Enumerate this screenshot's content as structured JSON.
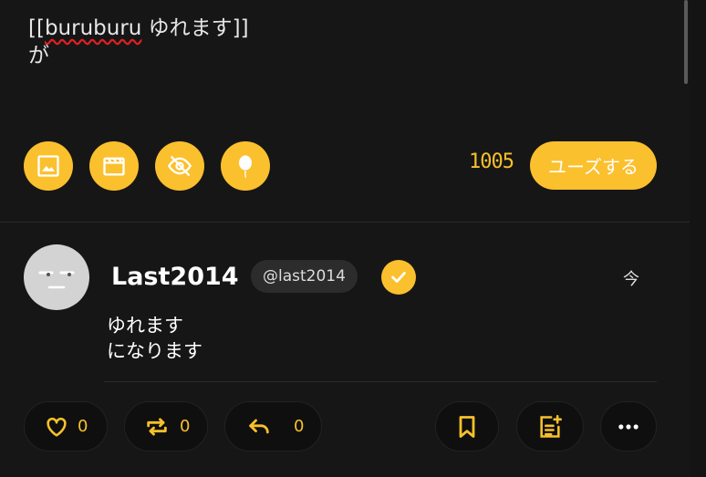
{
  "compose": {
    "line1_prefix": "[[",
    "line1_word": "buruburu",
    "line1_suffix": " ゆれます]]",
    "line2": "が"
  },
  "toolbar": {
    "icons": [
      "image-icon",
      "video-icon",
      "eye-off-icon",
      "balloon-icon"
    ],
    "char_count": "1005",
    "use_label": "ユーズする"
  },
  "post": {
    "display_name": "Last2014",
    "handle": "@last2014",
    "timestamp": "今",
    "body_line1": "ゆれます",
    "body_line2": "になります",
    "actions": {
      "like_count": "0",
      "repost_count": "0",
      "reply_count": "0"
    }
  },
  "colors": {
    "accent": "#fbc02d",
    "background": "#171616",
    "pill": "#0f0f0f"
  }
}
